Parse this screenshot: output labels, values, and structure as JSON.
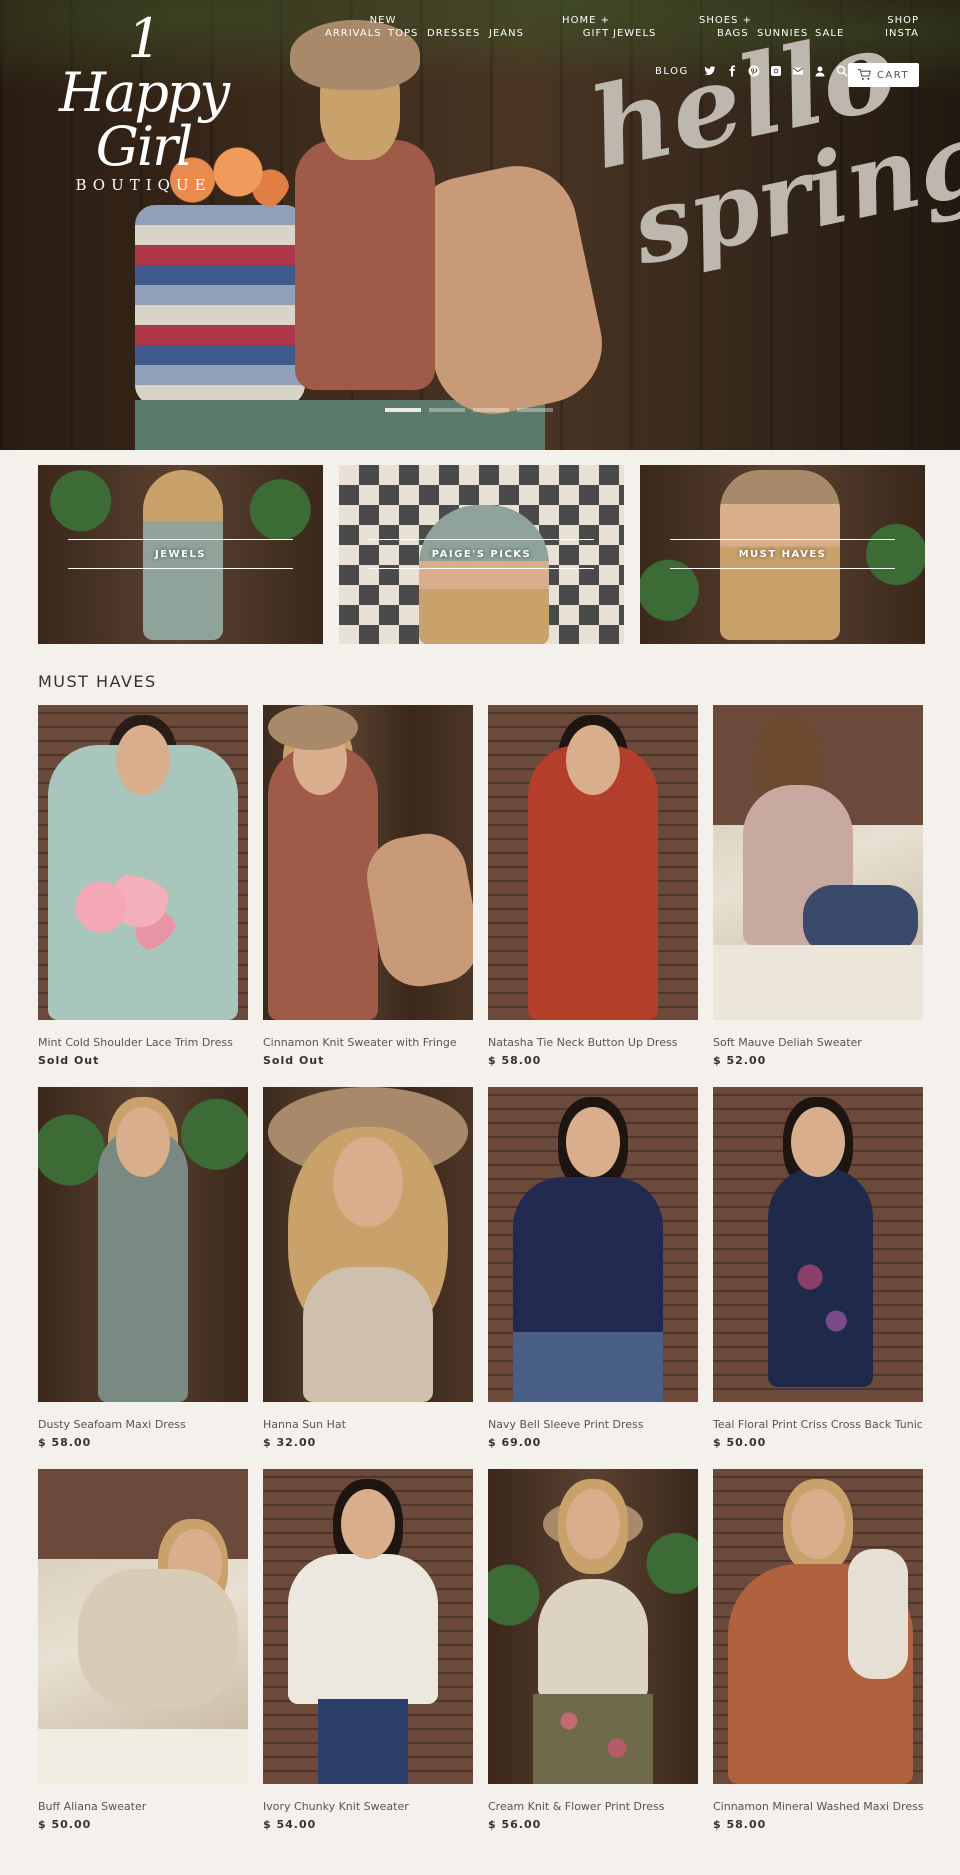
{
  "brand": {
    "name": "1 Happy Girl",
    "sub": "BOUTIQUE"
  },
  "nav": {
    "new_arrivals": [
      "NEW",
      "ARRIVALS"
    ],
    "tops": "TOPS",
    "dresses": "DRESSES",
    "jeans": "JEANS",
    "home_gift": [
      "HOME +",
      "GIFT"
    ],
    "jewels": "JEWELS",
    "shoes_bags": [
      "SHOES +",
      "BAGS"
    ],
    "sunnies": "SUNNIES",
    "sale": "SALE",
    "shop_insta": [
      "SHOP",
      "INSTA"
    ]
  },
  "utility": {
    "blog": "BLOG",
    "cart": "CART"
  },
  "hero": {
    "line1": "hello",
    "line2": "spring!"
  },
  "collections": [
    {
      "label": "JEWELS"
    },
    {
      "label": "PAIGE'S PICKS"
    },
    {
      "label": "MUST HAVES"
    }
  ],
  "section": {
    "title": "MUST HAVES"
  },
  "products": [
    {
      "title": "Mint Cold Shoulder Lace Trim Dress",
      "price": "Sold Out"
    },
    {
      "title": "Cinnamon Knit Sweater with Fringe",
      "price": "Sold Out"
    },
    {
      "title": "Natasha Tie Neck Button Up Dress",
      "price": "$ 58.00"
    },
    {
      "title": "Soft Mauve Deliah Sweater",
      "price": "$ 52.00"
    },
    {
      "title": "Dusty Seafoam Maxi Dress",
      "price": "$ 58.00"
    },
    {
      "title": "Hanna Sun Hat",
      "price": "$ 32.00"
    },
    {
      "title": "Navy Bell Sleeve Print Dress",
      "price": "$ 69.00"
    },
    {
      "title": "Teal Floral Print Criss Cross Back Tunic",
      "price": "$ 50.00"
    },
    {
      "title": "Buff Aliana Sweater",
      "price": "$ 50.00"
    },
    {
      "title": "Ivory Chunky Knit Sweater",
      "price": "$ 54.00"
    },
    {
      "title": "Cream Knit & Flower Print Dress",
      "price": "$ 56.00"
    },
    {
      "title": "Cinnamon Mineral Washed Maxi Dress",
      "price": "$ 58.00"
    }
  ],
  "colors": {
    "page_bg": "#f4f1ec",
    "text": "#333333",
    "cart_bg": "#ffffff"
  },
  "icons": [
    "twitter-icon",
    "facebook-icon",
    "pinterest-icon",
    "instagram-icon",
    "mail-icon",
    "account-icon",
    "search-icon",
    "cart-icon"
  ]
}
